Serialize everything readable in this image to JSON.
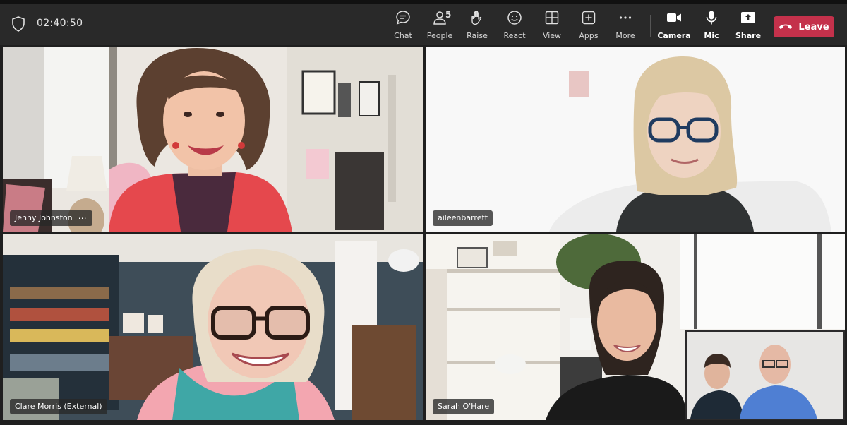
{
  "window": {
    "timer": "02:40:50"
  },
  "toolbar": {
    "chat_label": "Chat",
    "people_label": "People",
    "people_count": "5",
    "raise_label": "Raise",
    "react_label": "React",
    "view_label": "View",
    "apps_label": "Apps",
    "more_label": "More",
    "camera_label": "Camera",
    "mic_label": "Mic",
    "share_label": "Share",
    "leave_label": "Leave"
  },
  "participants": [
    {
      "name": "Jenny Johnston",
      "more": "⋯"
    },
    {
      "name": "aileenbarrett"
    },
    {
      "name": "Clare Morris (External)"
    },
    {
      "name": "Sarah O'Hare"
    }
  ],
  "colors": {
    "leave": "#c4314b",
    "toolbar": "#292929",
    "stage": "#1f1f1f"
  },
  "icons": {
    "security": "shield-icon",
    "chat": "chat-bubble-icon",
    "people": "people-icon",
    "raise": "raise-hand-icon",
    "react": "smiley-icon",
    "view": "grid-view-icon",
    "apps": "plus-box-icon",
    "more": "ellipsis-icon",
    "camera": "video-camera-icon",
    "mic": "microphone-icon",
    "share": "share-tray-icon",
    "leave": "phone-hangup-icon"
  }
}
